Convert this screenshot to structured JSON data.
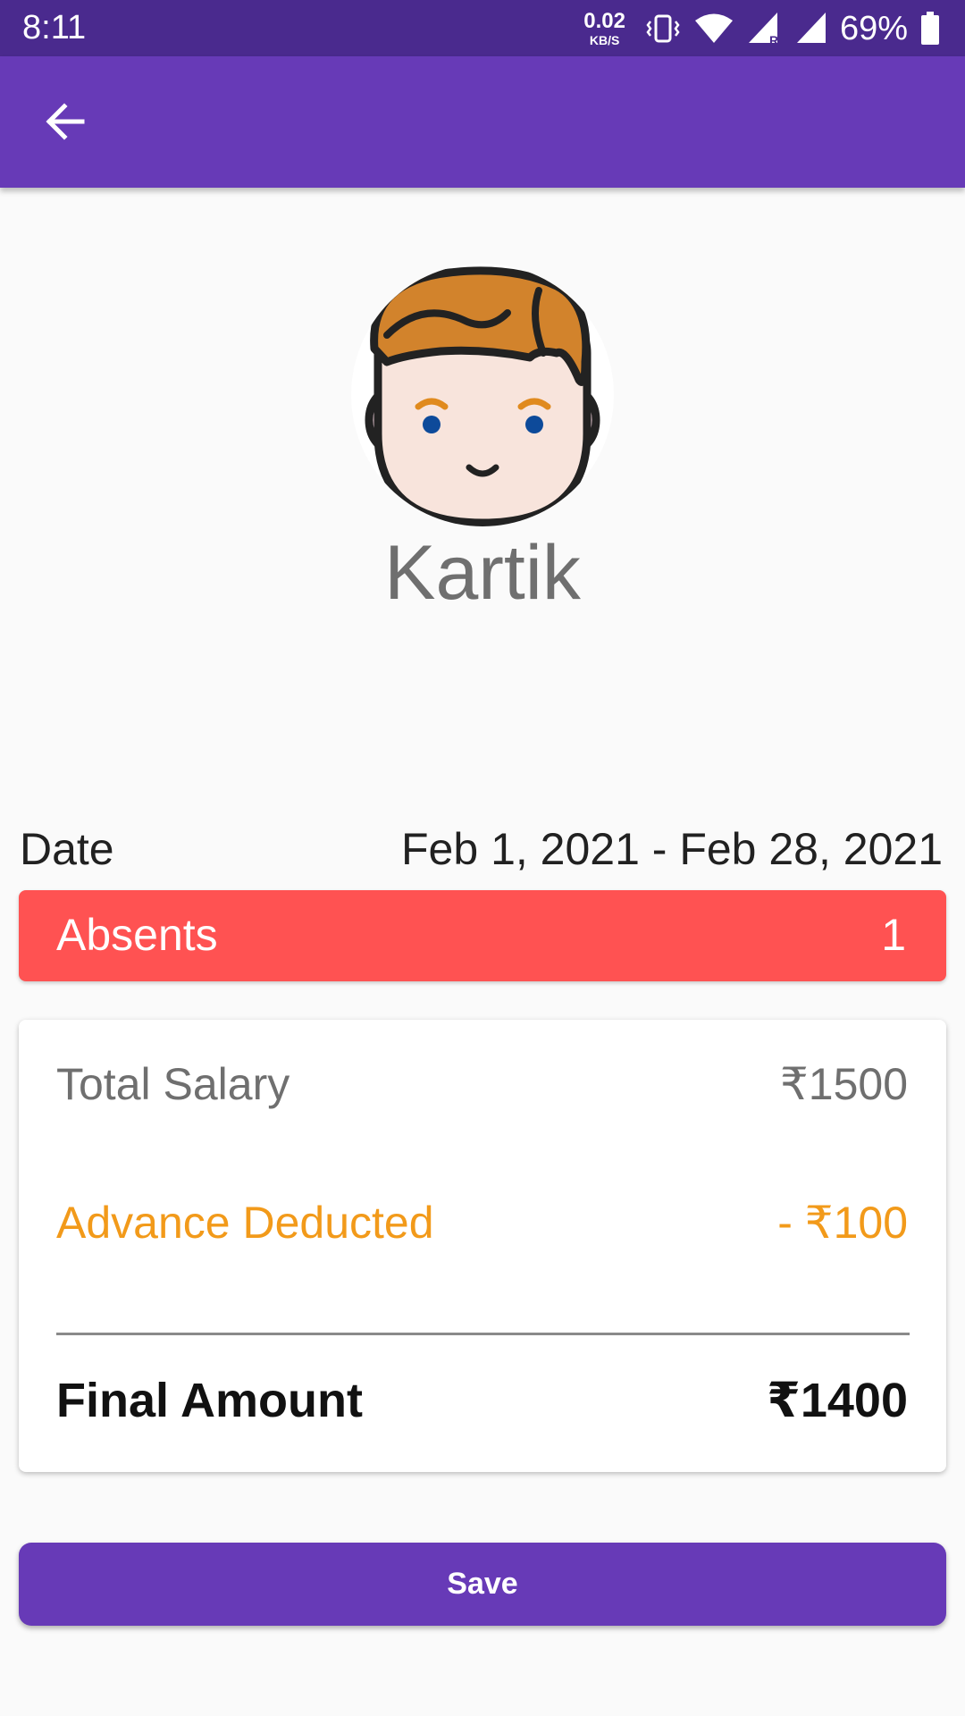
{
  "status_bar": {
    "time": "8:11",
    "net_speed_value": "0.02",
    "net_speed_unit": "KB/S",
    "battery_percent": "69%",
    "icons": [
      "vibrate-icon",
      "wifi-icon",
      "signal-roaming-icon",
      "signal-icon",
      "battery-icon"
    ]
  },
  "app_bar": {
    "back_icon": "arrow-back-icon"
  },
  "profile": {
    "name": "Kartik",
    "avatar": "boy-face-avatar"
  },
  "date": {
    "label": "Date",
    "value": "Feb 1, 2021 - Feb 28, 2021"
  },
  "absents": {
    "label": "Absents",
    "value": "1",
    "color": "#ff5252"
  },
  "salary": {
    "total_label": "Total Salary",
    "total_value": "₹1500",
    "advance_label": "Advance Deducted",
    "advance_value": "- ₹100",
    "advance_color": "#f29a1a",
    "final_label": "Final Amount",
    "final_value": "₹1400"
  },
  "actions": {
    "save_label": "Save"
  },
  "theme": {
    "primary": "#673ab7",
    "primary_dark": "#4a2a8e"
  }
}
